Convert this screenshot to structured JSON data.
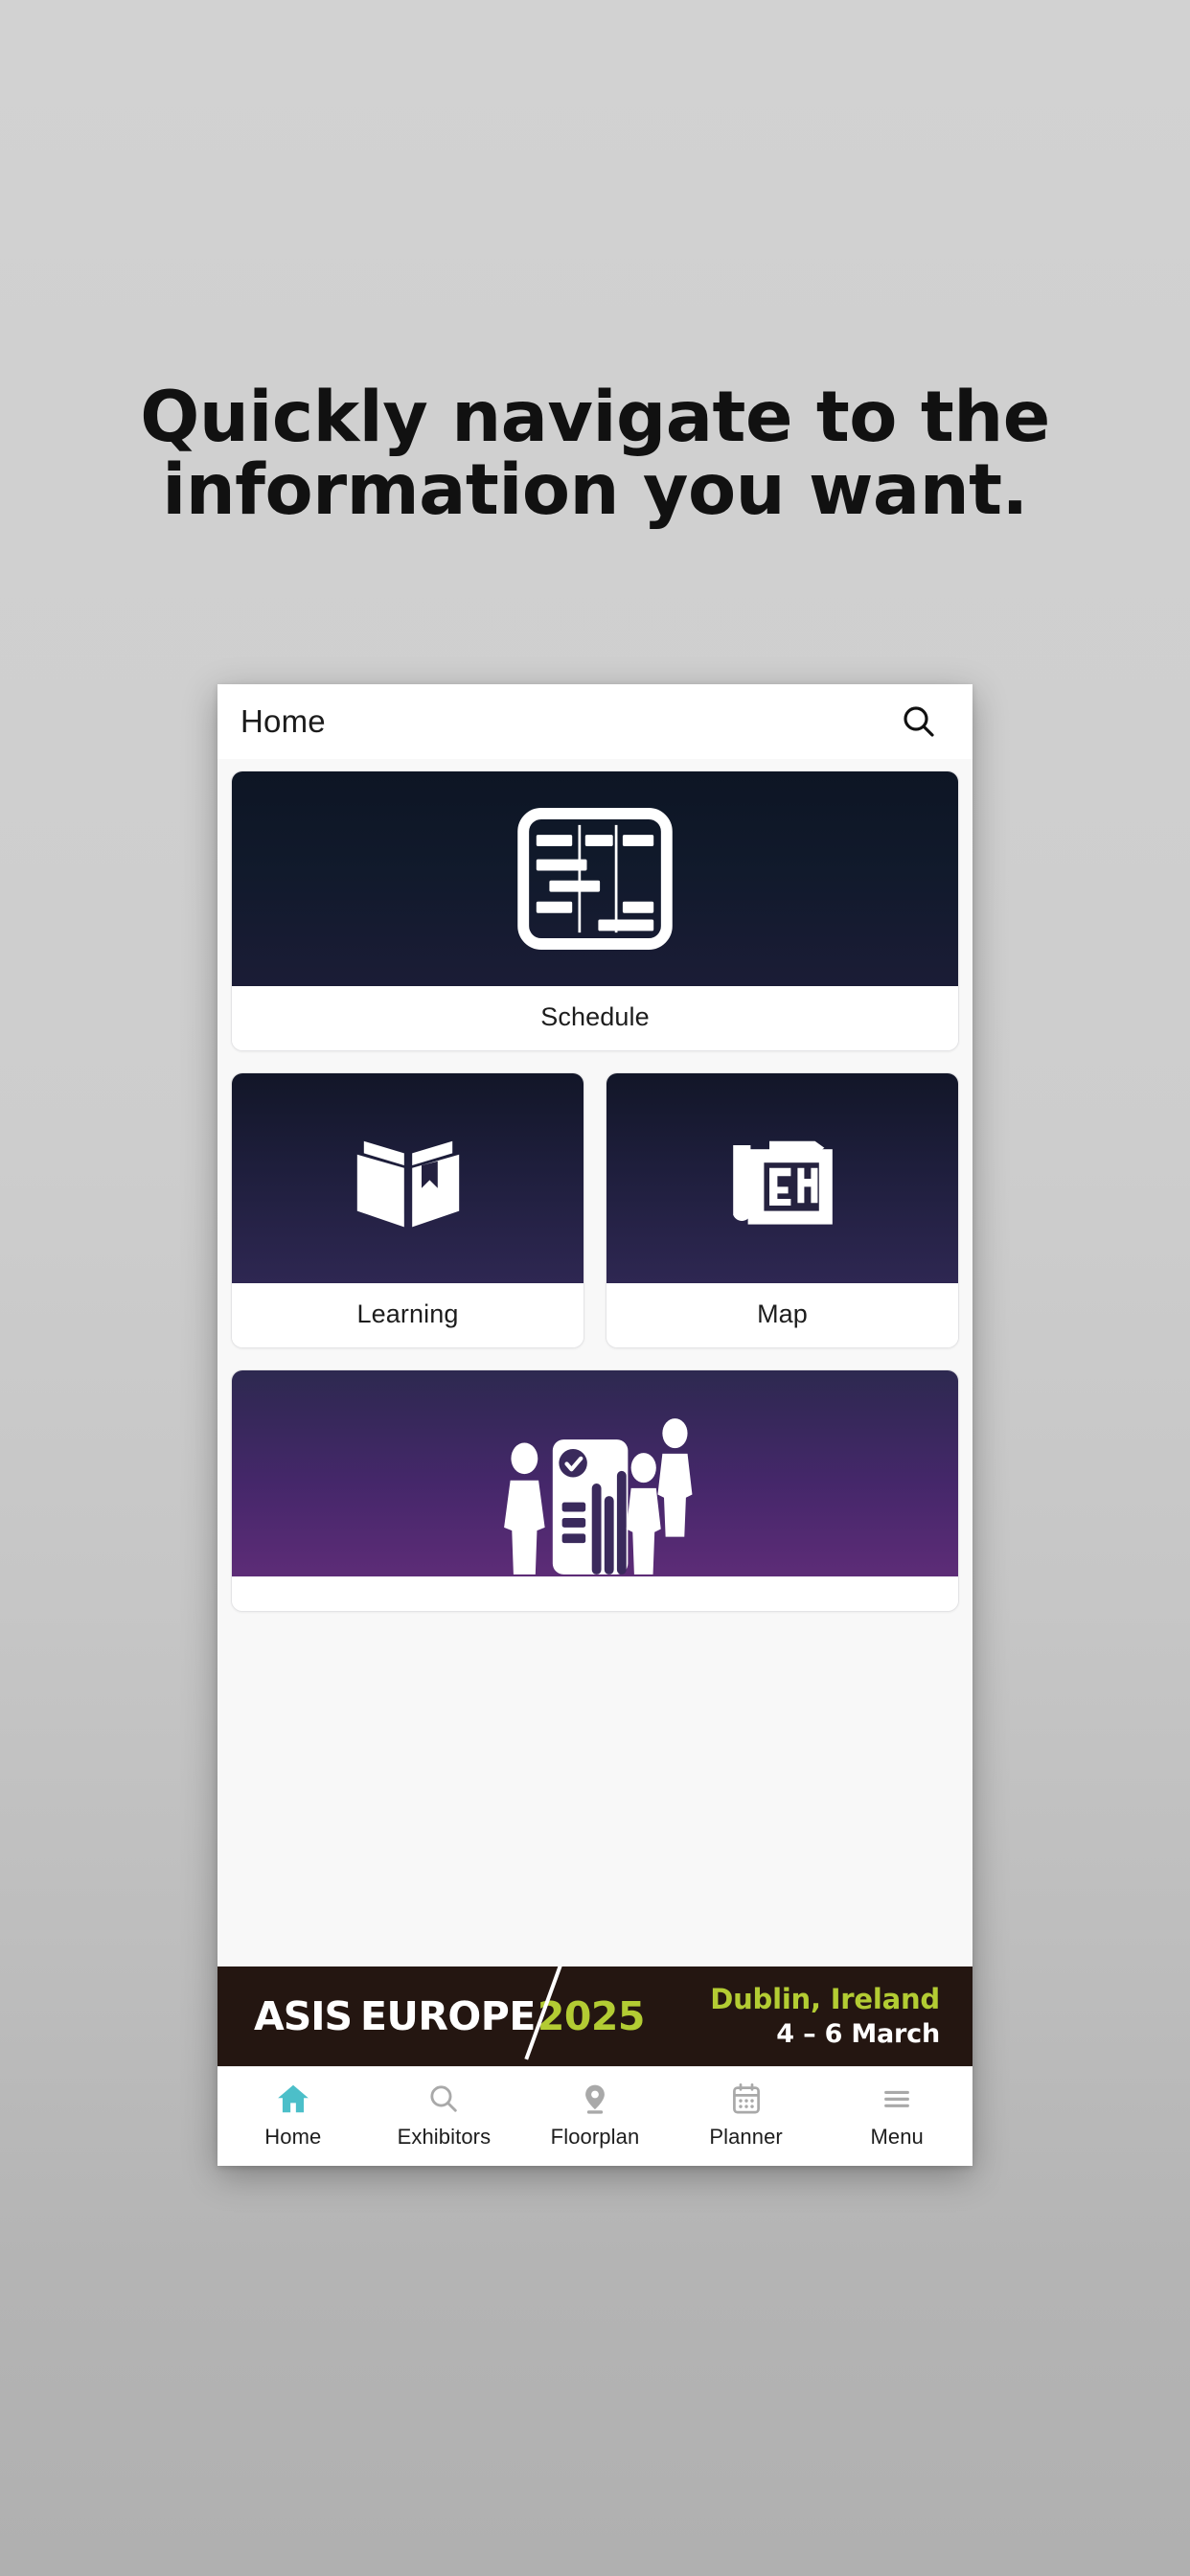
{
  "promo": {
    "headline_line1": "Quickly navigate to the",
    "headline_line2": "information you want."
  },
  "app": {
    "header": {
      "title": "Home",
      "search_icon": "search-icon"
    },
    "cards": [
      {
        "label": "Schedule",
        "icon": "schedule-grid-icon"
      },
      {
        "label": "Learning",
        "icon": "open-book-icon"
      },
      {
        "label": "Map",
        "icon": "blueprint-floorplan-icon"
      },
      {
        "label": "",
        "icon": "people-survey-chart-icon"
      }
    ],
    "sponsor_banner": {
      "logo_asis": "ASIS",
      "logo_europe": "EUROPE",
      "logo_year": "2025",
      "city": "Dublin, Ireland",
      "dates": "4 – 6 March"
    },
    "tabs": [
      {
        "label": "Home",
        "icon": "home-icon",
        "active": true
      },
      {
        "label": "Exhibitors",
        "icon": "search-icon",
        "active": false
      },
      {
        "label": "Floorplan",
        "icon": "map-pin-icon",
        "active": false
      },
      {
        "label": "Planner",
        "icon": "calendar-icon",
        "active": false
      },
      {
        "label": "Menu",
        "icon": "hamburger-icon",
        "active": false
      }
    ]
  },
  "colors": {
    "accent_teal": "#4cbfc9",
    "brand_lime": "#b3cc33",
    "banner_bg": "#241611",
    "tab_inactive": "#a9a9a9"
  }
}
